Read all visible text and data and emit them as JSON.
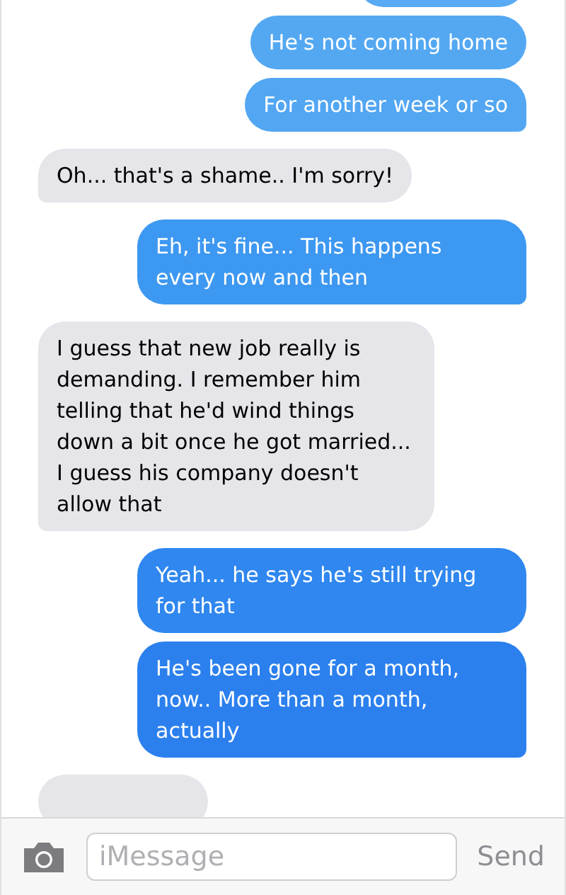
{
  "messages": [
    {
      "kind": "outgoing",
      "color": "#57aaf3",
      "tail": false
    },
    {
      "kind": "outgoing",
      "text": "He's not coming home",
      "color": "#54a8f2",
      "tail": false
    },
    {
      "kind": "outgoing",
      "text": "For another week or so",
      "color": "#52a6f2",
      "tail": true
    },
    {
      "kind": "incoming",
      "text": "Oh... that's a shame.. I'm sorry!",
      "color": "#e5e5ea",
      "tail": true
    },
    {
      "kind": "outgoing",
      "text": "Eh, it's fine... This happens every now and then",
      "color": "#3d98f1",
      "tail": true
    },
    {
      "kind": "incoming",
      "text": "I guess that new job really is demanding. I remember him telling that he'd wind things down a bit once he got married... I guess his company doesn't allow that",
      "color": "#e5e5ea",
      "tail": true
    },
    {
      "kind": "outgoing",
      "text": "Yeah... he says he's still trying for that",
      "color": "#2f87ef",
      "tail": false
    },
    {
      "kind": "outgoing",
      "text": "He's been gone for a month, now.. More than a month, actually",
      "color": "#2b80ee",
      "tail": true
    },
    {
      "kind": "incoming",
      "color": "#e5e5ea",
      "tail": false
    }
  ],
  "composer": {
    "placeholder": "iMessage",
    "send": "Send"
  }
}
